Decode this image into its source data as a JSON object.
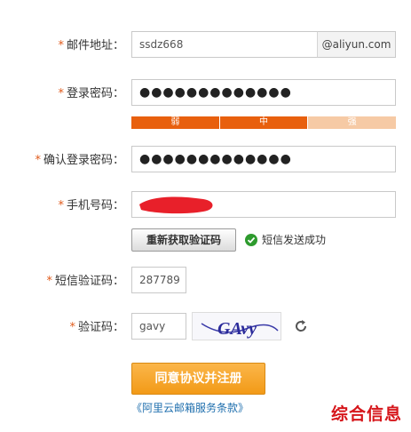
{
  "email": {
    "label": "邮件地址：",
    "value": "ssdz668",
    "domain": "@aliyun.com"
  },
  "password": {
    "label": "登录密码：",
    "value": "●●●●●●●●●●●●●"
  },
  "strength": {
    "weak": "弱",
    "medium": "中",
    "strong": "强",
    "colors": {
      "weak": "#e8600e",
      "medium": "#e8600e",
      "strong": "#f6caa5"
    }
  },
  "confirm_password": {
    "label": "确认登录密码：",
    "value": "●●●●●●●●●●●●●"
  },
  "phone": {
    "label": "手机号码："
  },
  "sms": {
    "resend_label": "重新获取验证码",
    "status_text": "短信发送成功"
  },
  "sms_code": {
    "label": "短信验证码：",
    "value": "287789"
  },
  "captcha": {
    "label": "验证码：",
    "value": "gavy",
    "image_text": "GAvy"
  },
  "submit": {
    "label": "同意协议并注册"
  },
  "terms_link": "《阿里云邮箱服务条款》",
  "watermark": "综合信息",
  "required_mark": "*"
}
